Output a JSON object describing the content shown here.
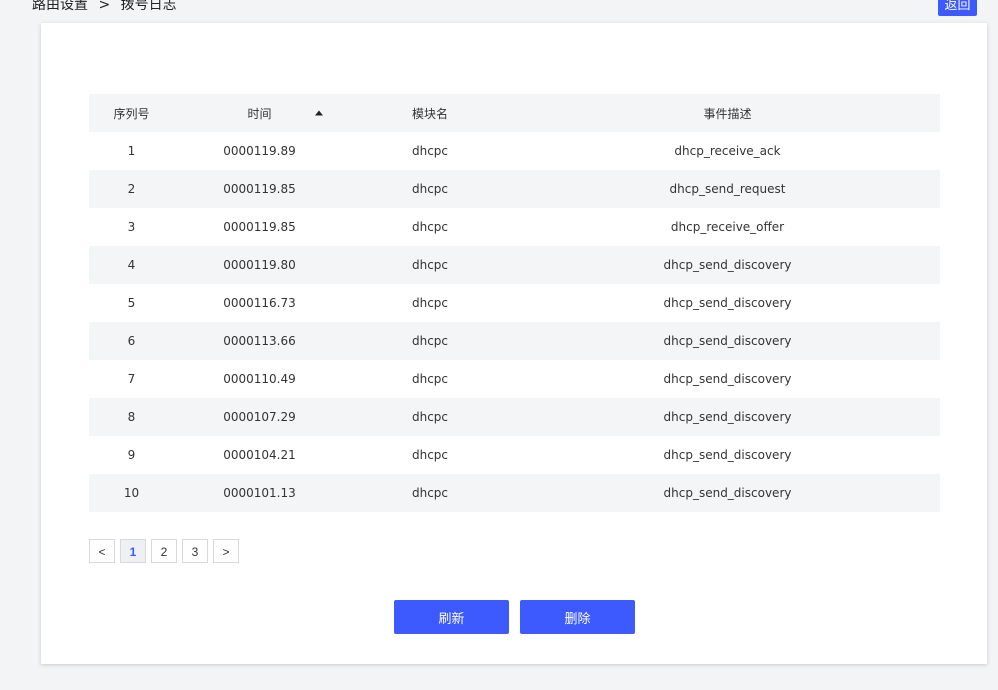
{
  "breadcrumb": {
    "parent": "路由设置",
    "separator": ">",
    "current": "拨号日志"
  },
  "back_button_label": "返回",
  "table": {
    "headers": {
      "seq": "序列号",
      "time": "时间",
      "module": "模块名",
      "description": "事件描述"
    },
    "sort": {
      "column": "time",
      "direction": "ascending-indicator"
    },
    "rows": [
      {
        "seq": "1",
        "time": "0000119.89",
        "module": "dhcpc",
        "description": "dhcp_receive_ack"
      },
      {
        "seq": "2",
        "time": "0000119.85",
        "module": "dhcpc",
        "description": "dhcp_send_request"
      },
      {
        "seq": "3",
        "time": "0000119.85",
        "module": "dhcpc",
        "description": "dhcp_receive_offer"
      },
      {
        "seq": "4",
        "time": "0000119.80",
        "module": "dhcpc",
        "description": "dhcp_send_discovery"
      },
      {
        "seq": "5",
        "time": "0000116.73",
        "module": "dhcpc",
        "description": "dhcp_send_discovery"
      },
      {
        "seq": "6",
        "time": "0000113.66",
        "module": "dhcpc",
        "description": "dhcp_send_discovery"
      },
      {
        "seq": "7",
        "time": "0000110.49",
        "module": "dhcpc",
        "description": "dhcp_send_discovery"
      },
      {
        "seq": "8",
        "time": "0000107.29",
        "module": "dhcpc",
        "description": "dhcp_send_discovery"
      },
      {
        "seq": "9",
        "time": "0000104.21",
        "module": "dhcpc",
        "description": "dhcp_send_discovery"
      },
      {
        "seq": "10",
        "time": "0000101.13",
        "module": "dhcpc",
        "description": "dhcp_send_discovery"
      }
    ]
  },
  "pagination": {
    "prev_label": "<",
    "next_label": ">",
    "pages": [
      "1",
      "2",
      "3"
    ],
    "current_page": "1"
  },
  "actions": {
    "refresh_label": "刷新",
    "delete_label": "删除"
  },
  "colors": {
    "primary": "#3d5afe",
    "header_bg": "#f4f5f7",
    "stripe_bg": "#f4f5f7",
    "page_bg": "#f3f4f6"
  },
  "icons": {
    "sort": "sort-ascending-icon"
  }
}
